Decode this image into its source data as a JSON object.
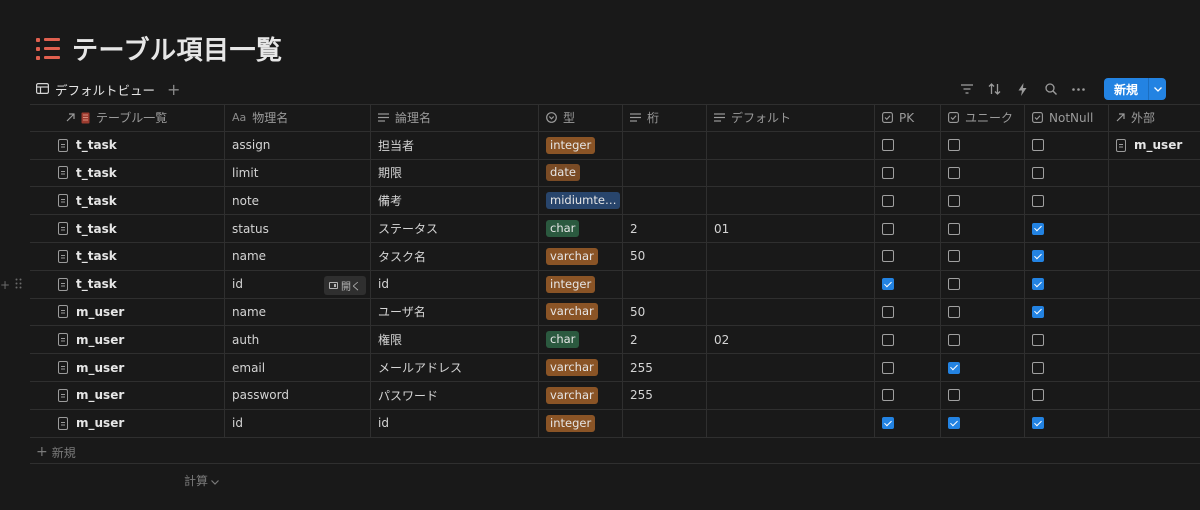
{
  "page": {
    "title": "テーブル項目一覧",
    "title_icon": "bulleted-list-icon",
    "title_icon_color": "#e0604f"
  },
  "view": {
    "tab_label": "デフォルトビュー",
    "tab_icon": "table-icon",
    "add_icon": "plus-icon"
  },
  "toolbar": {
    "icons": [
      "filter-icon",
      "sort-icon",
      "lightning-icon",
      "search-icon",
      "more-icon"
    ],
    "new_label": "新規",
    "new_caret_icon": "chevron-down-icon",
    "accent": "#2383e2"
  },
  "columns": [
    {
      "label": "テーブル一覧",
      "icon": "relation-arrow-icon"
    },
    {
      "label": "物理名",
      "icon": "title-aa-icon"
    },
    {
      "label": "論理名",
      "icon": "text-lines-icon"
    },
    {
      "label": "型",
      "icon": "select-icon"
    },
    {
      "label": "桁",
      "icon": "text-lines-icon"
    },
    {
      "label": "デフォルト",
      "icon": "text-lines-icon"
    },
    {
      "label": "PK",
      "icon": "checkbox-icon"
    },
    {
      "label": "ユニーク",
      "icon": "checkbox-icon"
    },
    {
      "label": "NotNull",
      "icon": "checkbox-icon"
    },
    {
      "label": "外部",
      "icon": "relation-arrow-icon"
    }
  ],
  "type_colors": {
    "integer": "#8a5426",
    "date": "#7a4b25",
    "midiumtext": "#28456c",
    "char": "#2b593f",
    "varchar": "#8a5426"
  },
  "rows": [
    {
      "table": "t_task",
      "physical": "assign",
      "logical": "担当者",
      "type": "integer",
      "type_display": "integer",
      "digits": "",
      "default": "",
      "pk": false,
      "unique": false,
      "notnull": false,
      "ref": "m_user"
    },
    {
      "table": "t_task",
      "physical": "limit",
      "logical": "期限",
      "type": "date",
      "type_display": "date",
      "digits": "",
      "default": "",
      "pk": false,
      "unique": false,
      "notnull": false,
      "ref": ""
    },
    {
      "table": "t_task",
      "physical": "note",
      "logical": "備考",
      "type": "midiumtext",
      "type_display": "midiumte…",
      "digits": "",
      "default": "",
      "pk": false,
      "unique": false,
      "notnull": false,
      "ref": ""
    },
    {
      "table": "t_task",
      "physical": "status",
      "logical": "ステータス",
      "type": "char",
      "type_display": "char",
      "digits": "2",
      "default": "01",
      "pk": false,
      "unique": false,
      "notnull": true,
      "ref": ""
    },
    {
      "table": "t_task",
      "physical": "name",
      "logical": "タスク名",
      "type": "varchar",
      "type_display": "varchar",
      "digits": "50",
      "default": "",
      "pk": false,
      "unique": false,
      "notnull": true,
      "ref": ""
    },
    {
      "table": "t_task",
      "physical": "id",
      "logical": "id",
      "type": "integer",
      "type_display": "integer",
      "digits": "",
      "default": "",
      "pk": true,
      "unique": false,
      "notnull": true,
      "ref": "",
      "hover_open_label": "開く"
    },
    {
      "table": "m_user",
      "physical": "name",
      "logical": "ユーザ名",
      "type": "varchar",
      "type_display": "varchar",
      "digits": "50",
      "default": "",
      "pk": false,
      "unique": false,
      "notnull": true,
      "ref": ""
    },
    {
      "table": "m_user",
      "physical": "auth",
      "logical": "権限",
      "type": "char",
      "type_display": "char",
      "digits": "2",
      "default": "02",
      "pk": false,
      "unique": false,
      "notnull": false,
      "ref": ""
    },
    {
      "table": "m_user",
      "physical": "email",
      "logical": "メールアドレス",
      "type": "varchar",
      "type_display": "varchar",
      "digits": "255",
      "default": "",
      "pk": false,
      "unique": true,
      "notnull": false,
      "ref": ""
    },
    {
      "table": "m_user",
      "physical": "password",
      "logical": "パスワード",
      "type": "varchar",
      "type_display": "varchar",
      "digits": "255",
      "default": "",
      "pk": false,
      "unique": false,
      "notnull": false,
      "ref": ""
    },
    {
      "table": "m_user",
      "physical": "id",
      "logical": "id",
      "type": "integer",
      "type_display": "integer",
      "digits": "",
      "default": "",
      "pk": true,
      "unique": true,
      "notnull": true,
      "ref": ""
    }
  ],
  "footer": {
    "add_row_label": "新規",
    "calc_label": "計算"
  }
}
